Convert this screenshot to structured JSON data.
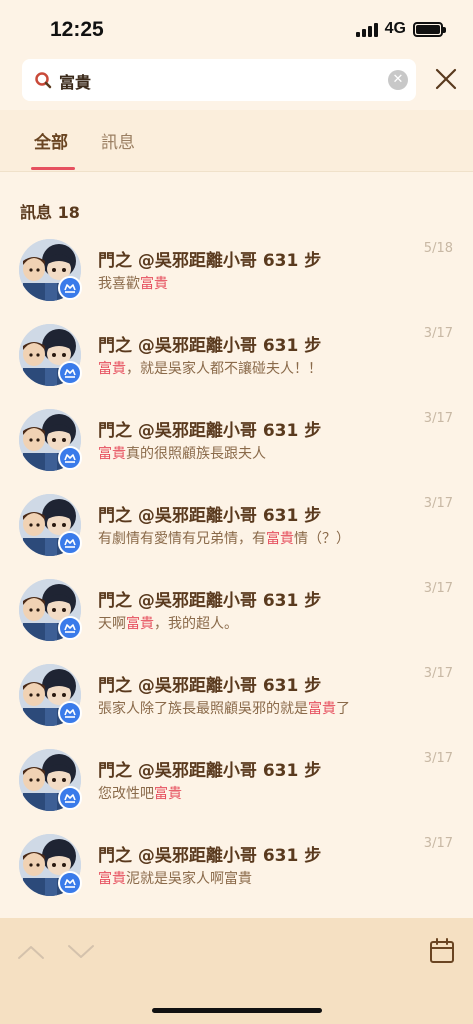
{
  "status": {
    "time": "12:25",
    "network": "4G"
  },
  "search": {
    "value": "富貴"
  },
  "tabs": [
    {
      "label": "全部",
      "active": true
    },
    {
      "label": "訊息",
      "active": false
    }
  ],
  "section": {
    "title": "訊息 18"
  },
  "items": [
    {
      "title": "門之 @吳邪距離小哥 631 步",
      "date": "5/18",
      "pre": "我喜歡",
      "hl": "富貴",
      "post": ""
    },
    {
      "title": "門之 @吳邪距離小哥 631 步",
      "date": "3/17",
      "pre": "",
      "hl": "富貴",
      "post": "，就是吳家人都不讓碰夫人！！"
    },
    {
      "title": "門之 @吳邪距離小哥 631 步",
      "date": "3/17",
      "pre": "",
      "hl": "富貴",
      "post": "真的很照顧族長跟夫人"
    },
    {
      "title": "門之 @吳邪距離小哥 631 步",
      "date": "3/17",
      "pre": "有劇情有愛情有兄弟情，有",
      "hl": "富貴",
      "post": "情（？）"
    },
    {
      "title": "門之 @吳邪距離小哥 631 步",
      "date": "3/17",
      "pre": "天啊",
      "hl": "富貴",
      "post": "，我的超人。"
    },
    {
      "title": "門之 @吳邪距離小哥 631 步",
      "date": "3/17",
      "pre": "張家人除了族長最照顧吳邪的就是",
      "hl": "富貴",
      "post": "了"
    },
    {
      "title": "門之 @吳邪距離小哥 631 步",
      "date": "3/17",
      "pre": "您改性吧",
      "hl": "富貴",
      "post": ""
    },
    {
      "title": "門之 @吳邪距離小哥 631 步",
      "date": "3/17",
      "pre": "",
      "hl": "富貴",
      "post": "泥就是吳家人啊富貴"
    }
  ],
  "colors": {
    "accent": "#e6505f",
    "background": "#fdf3e6",
    "badge": "#3a7bea"
  }
}
